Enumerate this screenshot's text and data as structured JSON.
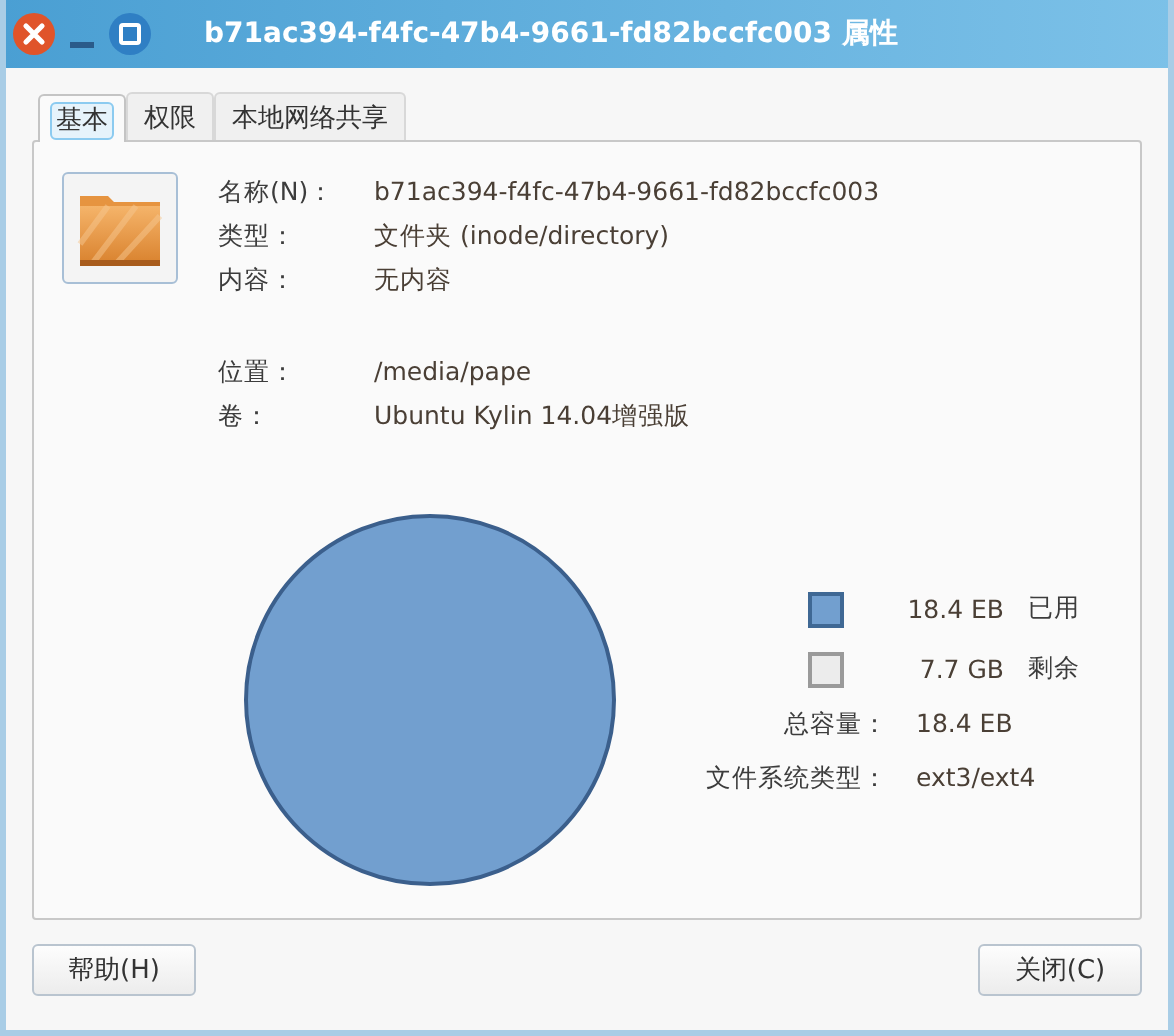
{
  "window": {
    "title": "b71ac394-f4fc-47b4-9661-fd82bccfc003 属性"
  },
  "tabs": [
    {
      "label": "基本",
      "selected": true
    },
    {
      "label": "权限",
      "selected": false
    },
    {
      "label": "本地网络共享",
      "selected": false
    }
  ],
  "info": [
    {
      "label": "名称(N)：",
      "value": "b71ac394-f4fc-47b4-9661-fd82bccfc003"
    },
    {
      "label": "类型：",
      "value": "文件夹 (inode/directory)"
    },
    {
      "label": "内容：",
      "value": "无内容"
    }
  ],
  "location": [
    {
      "label": "位置：",
      "value": "/media/pape"
    },
    {
      "label": "卷：",
      "value": "Ubuntu Kylin 14.04增强版"
    }
  ],
  "legend": [
    {
      "amount": "18.4 EB",
      "label": "已用",
      "color": "#729fcf"
    },
    {
      "amount": "7.7 GB",
      "label": "剩余",
      "color": "#ececec"
    }
  ],
  "totals": [
    {
      "label": "总容量：",
      "value": "18.4 EB"
    },
    {
      "label": "文件系统类型：",
      "value": "ext3/ext4"
    }
  ],
  "buttons": [
    {
      "label": "帮助(H)"
    },
    {
      "label": "关闭(C)"
    }
  ]
}
